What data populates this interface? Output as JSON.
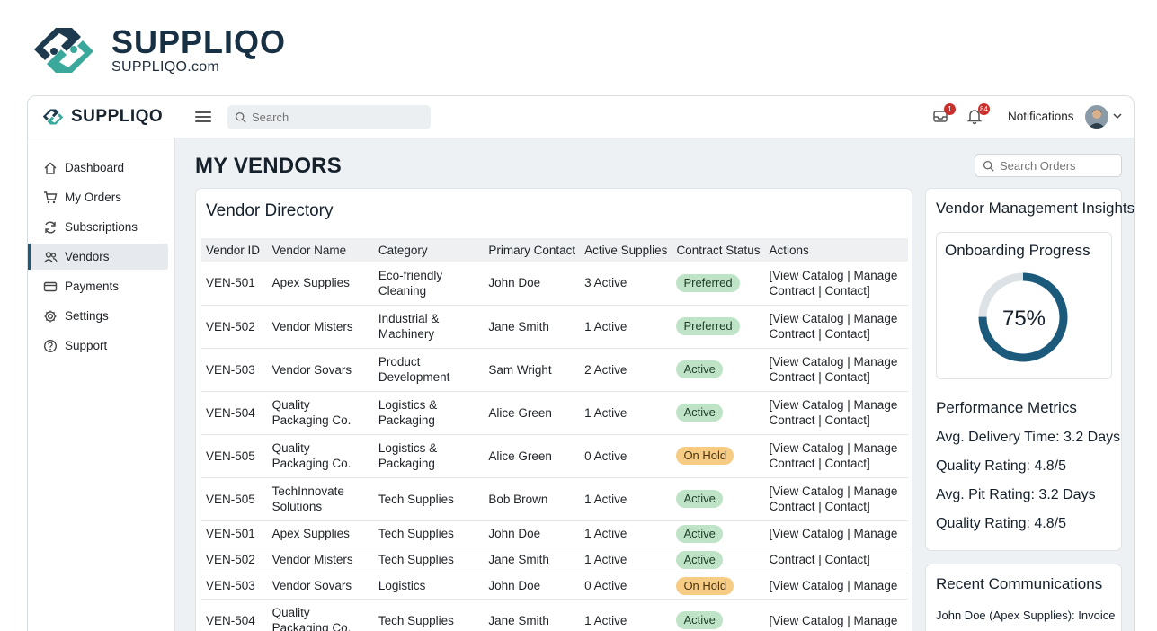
{
  "brand": {
    "name": "SUPPLIQO",
    "url": "SUPPLIQO.com"
  },
  "app": {
    "name": "SUPPLIQO"
  },
  "topbar": {
    "search_placeholder": "Search",
    "inbox_badge": "1",
    "bell_badge": "84",
    "notifications_label": "Notifications"
  },
  "sidebar": {
    "items": [
      {
        "label": "Dashboard",
        "icon": "home-icon"
      },
      {
        "label": "My Orders",
        "icon": "cart-icon"
      },
      {
        "label": "Subscriptions",
        "icon": "refresh-icon"
      },
      {
        "label": "Vendors",
        "icon": "users-icon"
      },
      {
        "label": "Payments",
        "icon": "credit-card-icon"
      },
      {
        "label": "Settings",
        "icon": "gear-icon"
      },
      {
        "label": "Support",
        "icon": "help-icon"
      }
    ],
    "active_index": 3
  },
  "main": {
    "title": "MY VENDORS",
    "orders_search_placeholder": "Search Orders"
  },
  "directory": {
    "title": "Vendor Directory",
    "columns": [
      "Vendor ID",
      "Vendor Name",
      "Category",
      "Primary Contact",
      "Active Supplies",
      "Contract Status",
      "Actions"
    ],
    "rows": [
      {
        "id": "VEN-501",
        "name": "Apex Supplies",
        "category": "Eco-friendly Cleaning",
        "contact": "John Doe",
        "supplies": "3 Active",
        "status": "Preferred",
        "status_color": "green",
        "actions": "[View Catalog | Manage Contract | Contact]",
        "tall": true
      },
      {
        "id": "VEN-502",
        "name": "Vendor Misters",
        "category": "Industrial & Machinery",
        "contact": "Jane Smith",
        "supplies": "1 Active",
        "status": "Preferred",
        "status_color": "green",
        "actions": "[View Catalog | Manage Contract | Contact]",
        "tall": true
      },
      {
        "id": "VEN-503",
        "name": "Vendor Sovars",
        "category": "Product Development",
        "contact": "Sam Wright",
        "supplies": "2 Active",
        "status": "Active",
        "status_color": "green",
        "actions": "[View Catalog | Manage Contract | Contact]",
        "tall": true
      },
      {
        "id": "VEN-504",
        "name": "Quality Packaging Co.",
        "category": "Logistics & Packaging",
        "contact": "Alice Green",
        "supplies": "1 Active",
        "status": "Active",
        "status_color": "green",
        "actions": "[View Catalog | Manage Contract | Contact]",
        "tall": true
      },
      {
        "id": "VEN-505",
        "name": "Quality Packaging Co.",
        "category": "Logistics & Packaging",
        "contact": "Alice Green",
        "supplies": "0 Active",
        "status": "On Hold",
        "status_color": "orange",
        "actions": "[View Catalog | Manage Contract | Contact]",
        "tall": true
      },
      {
        "id": "VEN-505",
        "name": "TechInnovate Solutions",
        "category": "Tech Supplies",
        "contact": "Bob Brown",
        "supplies": "1 Active",
        "status": "Active",
        "status_color": "green",
        "actions": "[View Catalog | Manage Contract | Contact]",
        "tall": true
      },
      {
        "id": "VEN-501",
        "name": "Apex Supplies",
        "category": "Tech Supplies",
        "contact": "John Doe",
        "supplies": "1 Active",
        "status": "Active",
        "status_color": "green",
        "actions": "[View Catalog | Manage",
        "tall": false
      },
      {
        "id": "VEN-502",
        "name": "Vendor Misters",
        "category": "Tech Supplies",
        "contact": "Jane Smith",
        "supplies": "1 Active",
        "status": "Active",
        "status_color": "green",
        "actions": "Contract | Contact]",
        "tall": false
      },
      {
        "id": "VEN-503",
        "name": "Vendor Sovars",
        "category": "Logistics",
        "contact": "John Doe",
        "supplies": "0 Active",
        "status": "On Hold",
        "status_color": "orange",
        "actions": "[View Catalog | Manage",
        "tall": false
      },
      {
        "id": "VEN-504",
        "name": "Quality Packaging Co.",
        "category": "Tech Supplies",
        "contact": "Jane Smith",
        "supplies": "1 Active",
        "status": "Active",
        "status_color": "green",
        "actions": "[View Catalog | Manage",
        "tall": true
      }
    ]
  },
  "insights": {
    "title": "Vendor Management Insights",
    "onboarding_title": "Onboarding Progress",
    "onboarding_value": "75%",
    "onboarding_fraction": 0.75,
    "performance_title": "Performance Metrics",
    "metrics": [
      "Avg. Delivery Time: 3.2 Days",
      "Quality Rating: 4.8/5",
      "Avg. Pit Rating: 3.2 Days",
      "Quality Rating: 4.8/5"
    ]
  },
  "communications": {
    "title": "Recent Communications",
    "items": [
      "John Doe (Apex Supplies): Invoice #..."
    ]
  },
  "colors": {
    "accent": "#1b5a7a",
    "logo_teal": "#3aa89a",
    "logo_navy": "#1e3a4f",
    "pill_green": "#bfe3c7",
    "pill_orange": "#f6cc85"
  }
}
